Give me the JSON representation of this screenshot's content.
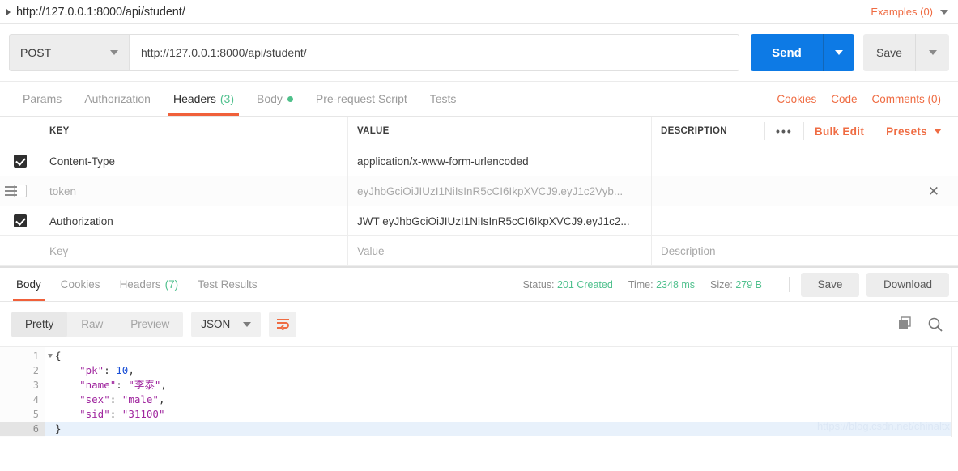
{
  "request_name_bar": {
    "expand_icon": "caret-right-icon",
    "title": "http://127.0.0.1:8000/api/student/",
    "examples_label": "Examples (0)",
    "examples_caret": "chevron-down-icon"
  },
  "url_row": {
    "method": "POST",
    "method_caret": "chevron-down-icon",
    "url": "http://127.0.0.1:8000/api/student/",
    "send_label": "Send",
    "send_caret": "chevron-down-icon",
    "save_label": "Save",
    "save_caret": "chevron-down-icon"
  },
  "request_tabs": {
    "items": [
      {
        "label": "Params",
        "active": false
      },
      {
        "label": "Authorization",
        "active": false
      },
      {
        "label": "Headers",
        "count": "(3)",
        "active": true
      },
      {
        "label": "Body",
        "dot": true,
        "active": false
      },
      {
        "label": "Pre-request Script",
        "active": false
      },
      {
        "label": "Tests",
        "active": false
      }
    ],
    "links": [
      {
        "label": "Cookies"
      },
      {
        "label": "Code"
      },
      {
        "label": "Comments (0)"
      }
    ]
  },
  "headers_table": {
    "columns": {
      "key": "KEY",
      "value": "VALUE",
      "description": "DESCRIPTION"
    },
    "actions": {
      "more": "•••",
      "bulk_edit": "Bulk Edit",
      "presets": "Presets",
      "presets_caret": "chevron-down-icon"
    },
    "rows": [
      {
        "checked": true,
        "key": "Content-Type",
        "value": "application/x-www-form-urlencoded",
        "description": "",
        "muted": false,
        "hovered": false
      },
      {
        "checked": false,
        "key": "token",
        "value": "eyJhbGciOiJIUzI1NiIsInR5cCI6IkpXVCJ9.eyJ1c2Vyb...",
        "description": "",
        "muted": true,
        "hovered": true,
        "has_drag_handle": true,
        "delete_icon": "close-icon"
      },
      {
        "checked": true,
        "key": "Authorization",
        "value": "JWT eyJhbGciOiJIUzI1NiIsInR5cCI6IkpXVCJ9.eyJ1c2...",
        "description": "",
        "muted": false,
        "hovered": false
      },
      {
        "checked": false,
        "key": "Key",
        "value": "Value",
        "description": "Description",
        "muted": true,
        "hovered": false,
        "placeholder_row": true
      }
    ]
  },
  "response_bar": {
    "tabs": [
      {
        "label": "Body",
        "active": true
      },
      {
        "label": "Cookies",
        "active": false
      },
      {
        "label": "Headers",
        "count": "(7)",
        "active": false
      },
      {
        "label": "Test Results",
        "active": false
      }
    ],
    "status_label": "Status:",
    "status_value": "201 Created",
    "time_label": "Time:",
    "time_value": "2348 ms",
    "size_label": "Size:",
    "size_value": "279 B",
    "save_label": "Save",
    "download_label": "Download"
  },
  "view_bar": {
    "modes": [
      {
        "label": "Pretty",
        "active": true
      },
      {
        "label": "Raw",
        "active": false
      },
      {
        "label": "Preview",
        "active": false
      }
    ],
    "format": "JSON",
    "format_caret": "chevron-down-icon",
    "wrap_icon": "word-wrap-icon",
    "copy_icon": "copy-icon",
    "search_icon": "search-icon"
  },
  "code_viewer": {
    "lines": [
      {
        "num": "1",
        "fold": true,
        "current": false,
        "tokens": [
          {
            "t": "pun",
            "s": "{"
          }
        ]
      },
      {
        "num": "2",
        "fold": false,
        "current": false,
        "tokens": [
          {
            "t": "key",
            "s": "    \"pk\""
          },
          {
            "t": "pun",
            "s": ": "
          },
          {
            "t": "num",
            "s": "10"
          },
          {
            "t": "pun",
            "s": ","
          }
        ]
      },
      {
        "num": "3",
        "fold": false,
        "current": false,
        "tokens": [
          {
            "t": "key",
            "s": "    \"name\""
          },
          {
            "t": "pun",
            "s": ": "
          },
          {
            "t": "str",
            "s": "\"李泰\""
          },
          {
            "t": "pun",
            "s": ","
          }
        ]
      },
      {
        "num": "4",
        "fold": false,
        "current": false,
        "tokens": [
          {
            "t": "key",
            "s": "    \"sex\""
          },
          {
            "t": "pun",
            "s": ": "
          },
          {
            "t": "str",
            "s": "\"male\""
          },
          {
            "t": "pun",
            "s": ","
          }
        ]
      },
      {
        "num": "5",
        "fold": false,
        "current": false,
        "tokens": [
          {
            "t": "key",
            "s": "    \"sid\""
          },
          {
            "t": "pun",
            "s": ": "
          },
          {
            "t": "str",
            "s": "\"31100\""
          }
        ]
      },
      {
        "num": "6",
        "fold": false,
        "current": true,
        "tokens": [
          {
            "t": "pun",
            "s": "}"
          }
        ]
      }
    ],
    "watermark": "https://blog.csdn.net/chinaltx"
  },
  "colors": {
    "accent_orange": "#ef6c43",
    "send_blue": "#0d7ae5",
    "success_green": "#4fc08d",
    "json_key_purple": "#a0279f",
    "json_number_blue": "#1a4fd6"
  }
}
